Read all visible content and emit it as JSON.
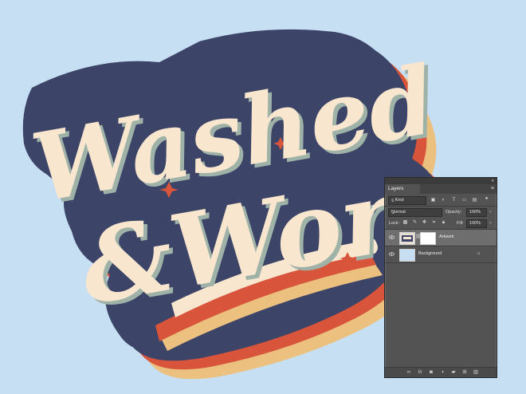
{
  "artwork": {
    "line1": "Washed",
    "line2": "&Worn",
    "colors": {
      "background": "#c6dff3",
      "cream": "#f8e6cf",
      "navy": "#3c4467",
      "red": "#d8543b",
      "tan": "#ecc17f",
      "sage": "#9fb2a8"
    }
  },
  "layers_panel": {
    "tab_label": "Layers",
    "filter_kind": "Kind",
    "blend_mode": "Normal",
    "opacity_label": "Opacity:",
    "opacity_value": "100%",
    "lock_label": "Lock:",
    "fill_label": "Fill:",
    "fill_value": "100%",
    "layers": [
      {
        "name": "Artwork",
        "selected": true
      },
      {
        "name": "Background",
        "selected": false,
        "locked": true
      }
    ],
    "icons": {
      "filter": [
        "image-filter-icon",
        "adjustment-filter-icon",
        "type-filter-icon",
        "shape-filter-icon",
        "smart-object-filter-icon",
        "filter-toggle-icon"
      ],
      "lock": [
        "lock-transparent-icon",
        "lock-paint-icon",
        "lock-move-icon",
        "lock-artboard-icon",
        "lock-all-icon"
      ],
      "bottom": [
        "link-icon",
        "fx-icon",
        "mask-icon",
        "adjustment-icon",
        "folder-icon",
        "new-layer-icon",
        "trash-icon"
      ]
    }
  }
}
